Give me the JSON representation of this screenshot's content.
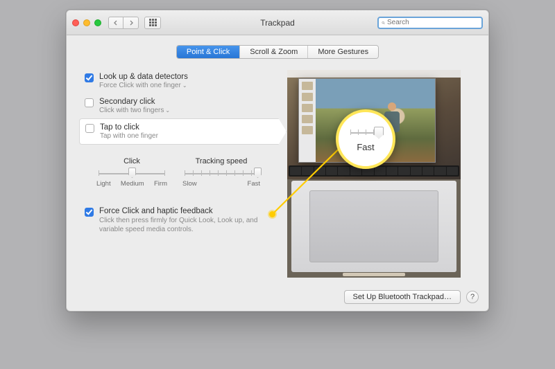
{
  "window": {
    "title": "Trackpad"
  },
  "search": {
    "placeholder": "Search"
  },
  "tabs": [
    {
      "label": "Point & Click",
      "active": true
    },
    {
      "label": "Scroll & Zoom",
      "active": false
    },
    {
      "label": "More Gestures",
      "active": false
    }
  ],
  "options": {
    "lookup": {
      "title": "Look up & data detectors",
      "subtitle": "Force Click with one finger",
      "checked": true
    },
    "secondary": {
      "title": "Secondary click",
      "subtitle": "Click with two fingers",
      "checked": false
    },
    "tap": {
      "title": "Tap to click",
      "subtitle": "Tap with one finger",
      "checked": false
    }
  },
  "sliders": {
    "click": {
      "label": "Click",
      "labels": [
        "Light",
        "Medium",
        "Firm"
      ]
    },
    "tracking": {
      "label": "Tracking speed",
      "labels": [
        "Slow",
        "Fast"
      ]
    }
  },
  "force": {
    "title": "Force Click and haptic feedback",
    "subtitle": "Click then press firmly for Quick Look, Look up, and variable speed media controls.",
    "checked": true
  },
  "footer": {
    "bluetooth": "Set Up Bluetooth Trackpad…",
    "help": "?"
  },
  "callout": {
    "text": "Fast"
  }
}
